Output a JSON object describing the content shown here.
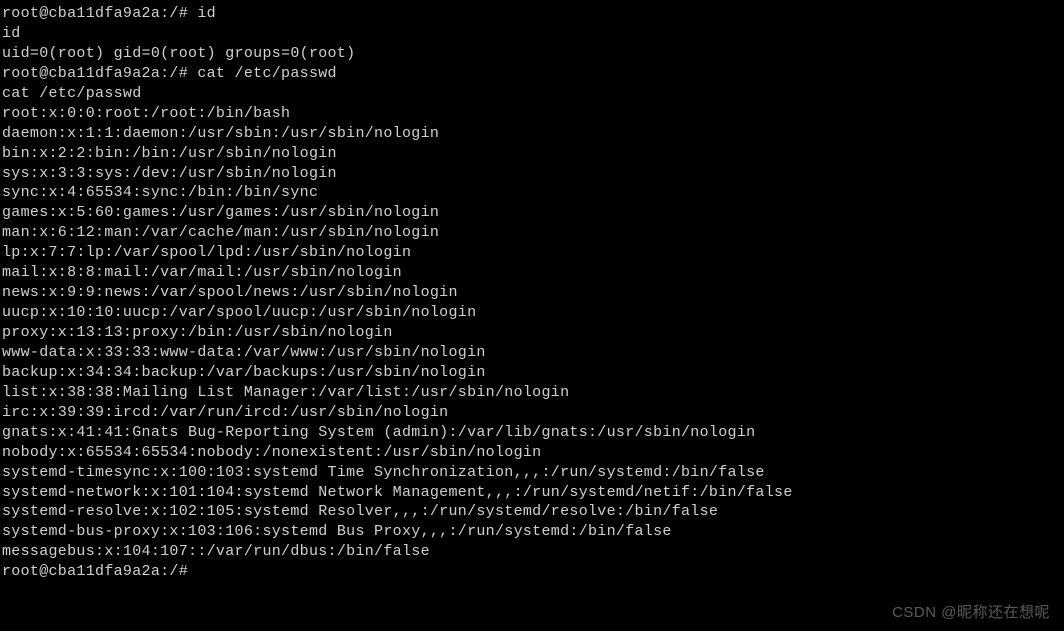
{
  "terminal": {
    "lines": [
      "root@cba11dfa9a2a:/# id",
      "id",
      "uid=0(root) gid=0(root) groups=0(root)",
      "root@cba11dfa9a2a:/# cat /etc/passwd",
      "cat /etc/passwd",
      "root:x:0:0:root:/root:/bin/bash",
      "daemon:x:1:1:daemon:/usr/sbin:/usr/sbin/nologin",
      "bin:x:2:2:bin:/bin:/usr/sbin/nologin",
      "sys:x:3:3:sys:/dev:/usr/sbin/nologin",
      "sync:x:4:65534:sync:/bin:/bin/sync",
      "games:x:5:60:games:/usr/games:/usr/sbin/nologin",
      "man:x:6:12:man:/var/cache/man:/usr/sbin/nologin",
      "lp:x:7:7:lp:/var/spool/lpd:/usr/sbin/nologin",
      "mail:x:8:8:mail:/var/mail:/usr/sbin/nologin",
      "news:x:9:9:news:/var/spool/news:/usr/sbin/nologin",
      "uucp:x:10:10:uucp:/var/spool/uucp:/usr/sbin/nologin",
      "proxy:x:13:13:proxy:/bin:/usr/sbin/nologin",
      "www-data:x:33:33:www-data:/var/www:/usr/sbin/nologin",
      "backup:x:34:34:backup:/var/backups:/usr/sbin/nologin",
      "list:x:38:38:Mailing List Manager:/var/list:/usr/sbin/nologin",
      "irc:x:39:39:ircd:/var/run/ircd:/usr/sbin/nologin",
      "gnats:x:41:41:Gnats Bug-Reporting System (admin):/var/lib/gnats:/usr/sbin/nologin",
      "nobody:x:65534:65534:nobody:/nonexistent:/usr/sbin/nologin",
      "systemd-timesync:x:100:103:systemd Time Synchronization,,,:/run/systemd:/bin/false",
      "systemd-network:x:101:104:systemd Network Management,,,:/run/systemd/netif:/bin/false",
      "systemd-resolve:x:102:105:systemd Resolver,,,:/run/systemd/resolve:/bin/false",
      "systemd-bus-proxy:x:103:106:systemd Bus Proxy,,,:/run/systemd:/bin/false",
      "messagebus:x:104:107::/var/run/dbus:/bin/false",
      "root@cba11dfa9a2a:/#"
    ]
  },
  "watermark": "CSDN @昵称还在想呢"
}
